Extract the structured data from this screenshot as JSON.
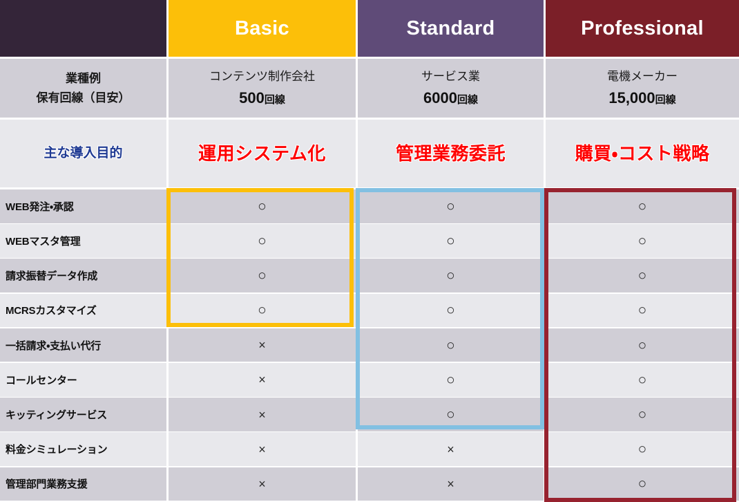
{
  "table": {
    "columns": [
      {
        "key": "label",
        "header": ""
      },
      {
        "key": "basic",
        "header": "Basic"
      },
      {
        "key": "standard",
        "header": "Standard"
      },
      {
        "key": "professional",
        "header": "Professional"
      }
    ],
    "header_colors": {
      "label": "#342539",
      "basic": "#FCBF09",
      "standard": "#5F4B78",
      "professional": "#7B1F28"
    },
    "industry_row": {
      "label_line1": "業種例",
      "label_line2": "保有回線（目安）",
      "basic": {
        "industry": "コンテンツ制作会社",
        "lines_number": "500",
        "lines_unit": "回線"
      },
      "standard": {
        "industry": "サービス業",
        "lines_number": "6000",
        "lines_unit": "回線"
      },
      "professional": {
        "industry": "電機メーカー",
        "lines_number": "15,000",
        "lines_unit": "回線"
      }
    },
    "purpose_row": {
      "label": "主な導入目的",
      "label_color": "#1F3A93",
      "value_color": "#FF0000",
      "basic": "運用システム化",
      "standard": "管理業務委託",
      "professional": "購買・コスト戦略"
    },
    "marks": {
      "yes": "○",
      "no": "×"
    },
    "features": [
      {
        "name": "WEB発注・承認",
        "basic": "○",
        "standard": "○",
        "professional": "○"
      },
      {
        "name": "WEBマスタ管理",
        "basic": "○",
        "standard": "○",
        "professional": "○"
      },
      {
        "name": "請求振替データ作成",
        "basic": "○",
        "standard": "○",
        "professional": "○"
      },
      {
        "name": "MCRSカスタマイズ",
        "basic": "○",
        "standard": "○",
        "professional": "○"
      },
      {
        "name": "一括請求・支払い代行",
        "basic": "×",
        "standard": "○",
        "professional": "○"
      },
      {
        "name": "コールセンター",
        "basic": "×",
        "standard": "○",
        "professional": "○"
      },
      {
        "name": "キッティングサービス",
        "basic": "×",
        "standard": "○",
        "professional": "○"
      },
      {
        "name": "料金シミュレーション",
        "basic": "×",
        "standard": "×",
        "professional": "○"
      },
      {
        "name": "管理部門業務支援",
        "basic": "×",
        "standard": "×",
        "professional": "○"
      }
    ],
    "highlights": [
      {
        "column": "basic",
        "color": "#FCBF09",
        "rows_covered": 4
      },
      {
        "column": "standard",
        "color": "#82C0E2",
        "rows_covered": 7
      },
      {
        "column": "professional",
        "color": "#97222F",
        "rows_covered": 9
      }
    ]
  }
}
